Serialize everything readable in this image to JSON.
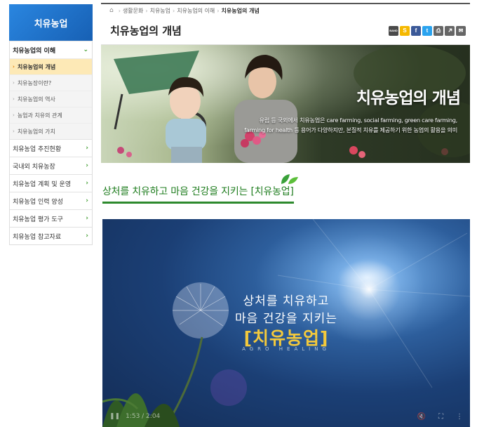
{
  "sidebar": {
    "title": "치유농업",
    "items": [
      {
        "label": "치유농업의 이해",
        "open": true,
        "children": [
          {
            "label": "치유농업의 개념",
            "active": true
          },
          {
            "label": "치유농장이란?"
          },
          {
            "label": "치유농업의 역사"
          },
          {
            "label": "농업과 치유의 관계"
          },
          {
            "label": "치유농업의 가치"
          }
        ]
      },
      {
        "label": "치유농업 추진현황"
      },
      {
        "label": "국내외 치유농장"
      },
      {
        "label": "치유농업 계획 및 운영"
      },
      {
        "label": "치유농업 인력 양성"
      },
      {
        "label": "치유농업 평가 도구"
      },
      {
        "label": "치유농업 참고자료"
      }
    ]
  },
  "breadcrumb": [
    "생활문화",
    "치유농업",
    "치유농업의 이해",
    "치유농업의 개념"
  ],
  "page_title": "치유농업의 개념",
  "share": [
    {
      "icon": "band-icon",
      "label": "BAND",
      "color": "#4a4a4a"
    },
    {
      "icon": "kakao-story-icon",
      "label": "S",
      "color": "#f5b800"
    },
    {
      "icon": "facebook-icon",
      "label": "f",
      "color": "#3b5998"
    },
    {
      "icon": "twitter-icon",
      "label": "t",
      "color": "#2aa3ef"
    },
    {
      "icon": "print-icon",
      "label": "⎙",
      "color": "#666"
    },
    {
      "icon": "link-icon",
      "label": "🔗",
      "color": "#666"
    },
    {
      "icon": "mail-icon",
      "label": "✉",
      "color": "#666"
    }
  ],
  "banner": {
    "title": "치유농업의 개념",
    "desc_line1": "유럽 등 국외에서 치유농업은 care farming, social farming, green care farming,",
    "desc_line2": "farming for health 등 용어가 다양하지만, 본질적 치유를 제공하기 위한 농업의 활용을 의미"
  },
  "section_title": "상처를 치유하고 마음 건강을 지키는 [치유농업]",
  "video": {
    "line1": "상처를 치유하고",
    "line2": "마음 건강을 지키는",
    "line3": "[치유농업]",
    "line4": "AGRO HEALING",
    "time": "1:53 / 2:04"
  }
}
